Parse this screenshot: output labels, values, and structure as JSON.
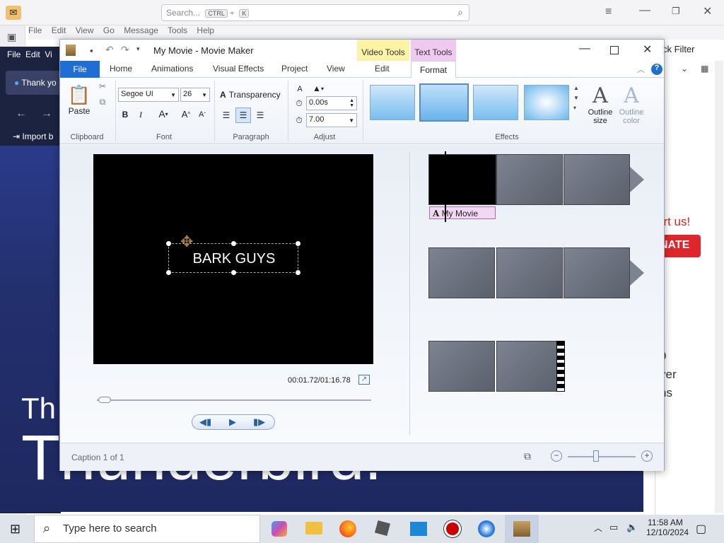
{
  "thunderbird": {
    "search_placeholder": "Search...",
    "search_kbd1": "CTRL",
    "search_kbd_plus": "+",
    "search_kbd2": "K",
    "menu": [
      "File",
      "Edit",
      "View",
      "Go",
      "Message",
      "Tools",
      "Help"
    ],
    "dark_menu": [
      "File",
      "Edit",
      "Vi"
    ],
    "thank_tab": "Thank yo",
    "import": "Import b",
    "quick_filter": "ck Filter",
    "support": "ort us!",
    "donate": "NATE",
    "right_text1": "9",
    "right_text2": "ver",
    "right_text3": "ns",
    "big_text1": "Th",
    "big_text2": "Thunderbird."
  },
  "moviemaker": {
    "title": "My Movie - Movie Maker",
    "context_video": "Video Tools",
    "context_text": "Text Tools",
    "tabs": [
      "File",
      "Home",
      "Animations",
      "Visual Effects",
      "Project",
      "View",
      "Edit",
      "Format"
    ],
    "clipboard": {
      "paste": "Paste",
      "label": "Clipboard"
    },
    "font": {
      "family": "Segoe UI",
      "size": "26",
      "label": "Font"
    },
    "paragraph": {
      "transparency": "Transparency",
      "label": "Paragraph"
    },
    "adjust": {
      "start": "0.00s",
      "duration": "7.00",
      "label": "Adjust"
    },
    "effects": {
      "label": "Effects",
      "outline_size": "Outline size",
      "outline_color": "Outline color"
    },
    "preview_caption": "BARK GUYS",
    "timecode": "00:01.72/01:16.78",
    "caption_label": "My Movie",
    "status": "Caption 1 of 1"
  },
  "taskbar": {
    "search_placeholder": "Type here to search",
    "time": "11:58 AM",
    "date": "12/10/2024"
  }
}
